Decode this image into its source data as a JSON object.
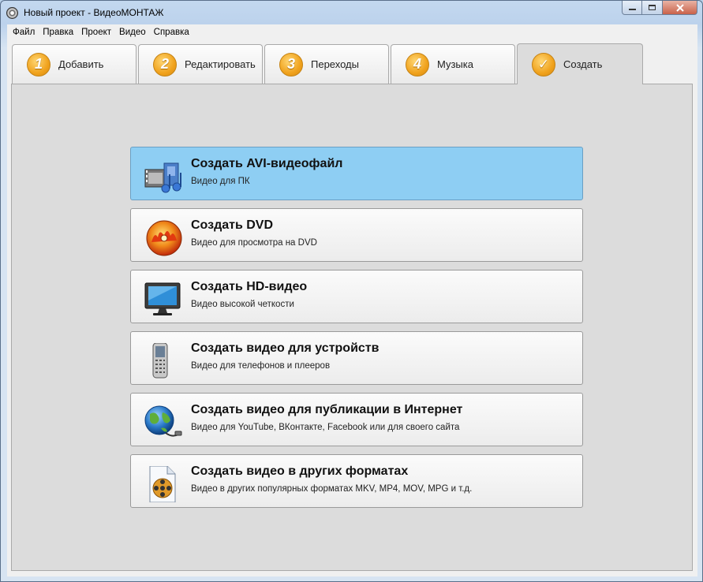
{
  "window": {
    "title": "Новый проект - ВидеоМОНТАЖ"
  },
  "menu": [
    "Файл",
    "Правка",
    "Проект",
    "Видео",
    "Справка"
  ],
  "tabs": [
    {
      "num": "1",
      "label": "Добавить"
    },
    {
      "num": "2",
      "label": "Редактировать"
    },
    {
      "num": "3",
      "label": "Переходы"
    },
    {
      "num": "4",
      "label": "Музыка"
    },
    {
      "num": "✓",
      "label": "Создать"
    }
  ],
  "options": [
    {
      "title": "Создать AVI-видеофайл",
      "subtitle": "Видео для ПК",
      "icon": "film-music-icon"
    },
    {
      "title": "Создать DVD",
      "subtitle": "Видео для просмотра на DVD",
      "icon": "dvd-disc-icon"
    },
    {
      "title": "Создать HD-видео",
      "subtitle": "Видео высокой четкости",
      "icon": "hd-monitor-icon"
    },
    {
      "title": "Создать видео для устройств",
      "subtitle": "Видео для телефонов и плееров",
      "icon": "mobile-phone-icon"
    },
    {
      "title": "Создать видео для публикации в Интернет",
      "subtitle": "Видео для YouTube, ВКонтакте, Facebook или для своего сайта",
      "icon": "globe-icon"
    },
    {
      "title": "Создать видео в других форматах",
      "subtitle": "Видео в других популярных форматах MKV, MP4, MOV, MPG и т.д.",
      "icon": "video-file-icon"
    }
  ],
  "colors": {
    "highlight": "#8ecef3",
    "tab_badge": "#f0a21d"
  }
}
